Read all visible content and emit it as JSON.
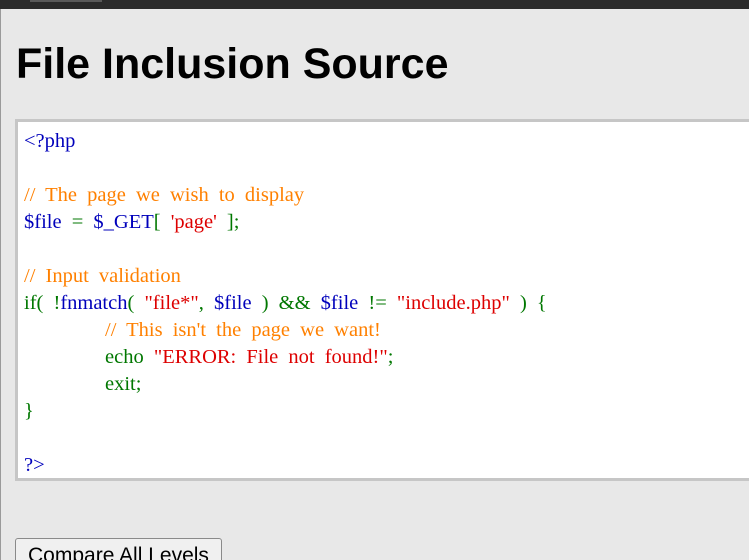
{
  "page": {
    "title": "File Inclusion Source"
  },
  "colors": {
    "default": "#0000bb",
    "keyword": "#007700",
    "comment": "#ff8000",
    "string": "#dd0000"
  },
  "source_lines": [
    [
      {
        "t": "<?php",
        "c": "default"
      }
    ],
    [],
    [
      {
        "t": "// The page we wish to display",
        "c": "comment"
      }
    ],
    [
      {
        "t": "$file ",
        "c": "default"
      },
      {
        "t": "= ",
        "c": "keyword"
      },
      {
        "t": "$_GET",
        "c": "default"
      },
      {
        "t": "[ ",
        "c": "keyword"
      },
      {
        "t": "'page'",
        "c": "string"
      },
      {
        "t": " ];",
        "c": "keyword"
      }
    ],
    [],
    [
      {
        "t": "// Input validation",
        "c": "comment"
      }
    ],
    [
      {
        "t": "if( ",
        "c": "keyword"
      },
      {
        "t": "!",
        "c": "keyword"
      },
      {
        "t": "fnmatch",
        "c": "default"
      },
      {
        "t": "( ",
        "c": "keyword"
      },
      {
        "t": "\"file*\"",
        "c": "string"
      },
      {
        "t": ", ",
        "c": "keyword"
      },
      {
        "t": "$file ",
        "c": "default"
      },
      {
        "t": ") && ",
        "c": "keyword"
      },
      {
        "t": "$file ",
        "c": "default"
      },
      {
        "t": "!= ",
        "c": "keyword"
      },
      {
        "t": "\"include.php\" ",
        "c": "string"
      },
      {
        "t": ") {",
        "c": "keyword"
      }
    ],
    [
      {
        "t": "        ",
        "c": "keyword"
      },
      {
        "t": "// This isn't the page we want!",
        "c": "comment"
      }
    ],
    [
      {
        "t": "        echo ",
        "c": "keyword"
      },
      {
        "t": "\"ERROR: File not found!\"",
        "c": "string"
      },
      {
        "t": ";",
        "c": "keyword"
      }
    ],
    [
      {
        "t": "        exit;",
        "c": "keyword"
      }
    ],
    [
      {
        "t": "}",
        "c": "keyword"
      }
    ],
    [],
    [
      {
        "t": "?>",
        "c": "default"
      }
    ]
  ],
  "buttons": {
    "compare_label": "Compare All Levels"
  }
}
